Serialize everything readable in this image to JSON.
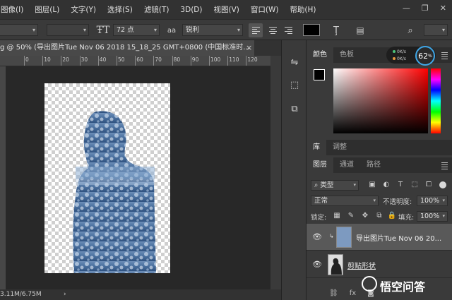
{
  "menubar": {
    "items": [
      "图像(I)",
      "图层(L)",
      "文字(Y)",
      "选择(S)",
      "滤镜(T)",
      "3D(D)",
      "视图(V)",
      "窗口(W)",
      "帮助(H)"
    ]
  },
  "window_controls": {
    "minimize": "—",
    "maximize": "❐",
    "close": "✕"
  },
  "optionsbar": {
    "font_size": "72 点",
    "antialias_icon_label": "aa",
    "antialias": "锐利",
    "text_color": "#000000",
    "align_active": "left"
  },
  "document": {
    "tab_title": "g @ 50% (导出图片Tue Nov 06 2018 15_18_25 GMT+0800 (中国标准时...",
    "close": "×",
    "ruler_ticks": [
      "0",
      "10",
      "20",
      "30",
      "40",
      "50",
      "60",
      "70",
      "80",
      "90",
      "100",
      "110",
      "120"
    ],
    "status": "3.11M/6.75M",
    "status_arrow": "›"
  },
  "color_panel": {
    "tabs": [
      "颜色",
      "色板"
    ],
    "foreground": "#000000",
    "background": "#ffffff",
    "hue": "#ff0000"
  },
  "performance": {
    "line1": "0K/s",
    "line2": "0K/s",
    "percent": "62",
    "percent_unit": "%"
  },
  "library_panel": {
    "tabs": [
      "库",
      "调整"
    ]
  },
  "layers_panel": {
    "tabs": [
      "图层",
      "通道",
      "路径"
    ],
    "filter": "类型",
    "blend_mode": "正常",
    "opacity_label": "不透明度:",
    "opacity": "100%",
    "lock_label": "锁定:",
    "fill_label": "填充:",
    "fill": "100%",
    "layers": [
      {
        "name": "导出图片Tue Nov 06 20...",
        "selected": true,
        "visible": true,
        "clipped": true
      },
      {
        "name": "剪贴形状",
        "selected": false,
        "visible": true,
        "clipped": false
      }
    ]
  },
  "watermark": {
    "text": "悟空问答"
  }
}
